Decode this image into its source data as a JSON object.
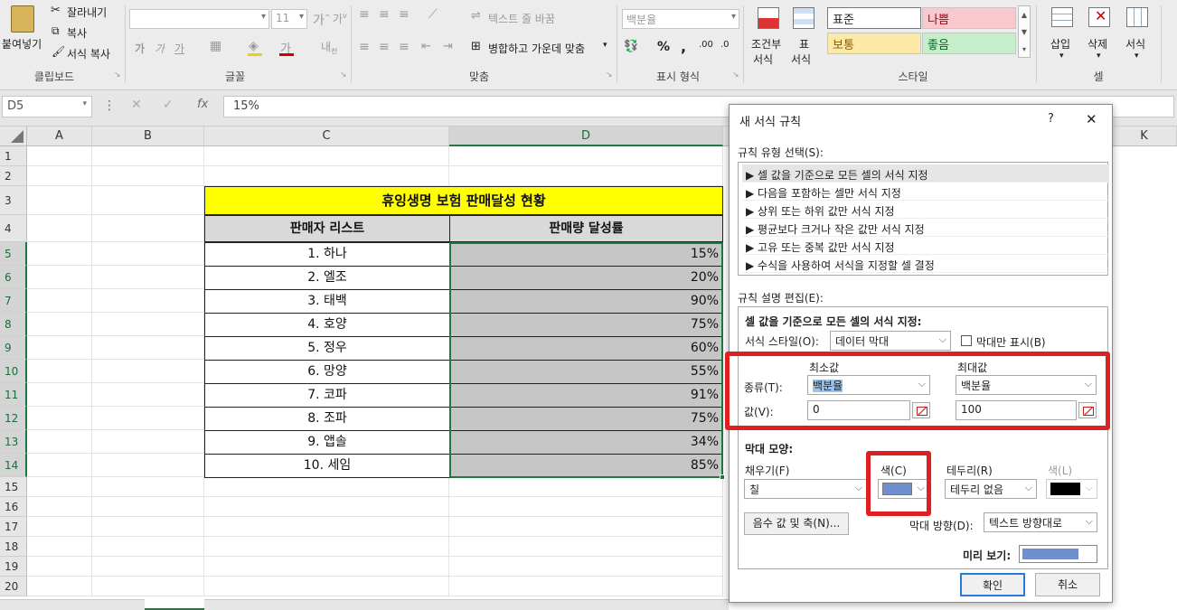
{
  "ribbon": {
    "clipboard": {
      "paste": "붙여넣기",
      "cut": "잘라내기",
      "copy": "복사",
      "format_painter": "서식 복사",
      "group": "클립보드"
    },
    "font": {
      "font_name": "",
      "font_size": "11",
      "bold": "가",
      "italic": "가",
      "underline": "가",
      "group": "글꼴"
    },
    "alignment": {
      "wrap_text": "텍스트 줄 바꿈",
      "merge_center": "병합하고 가운데 맞춤",
      "group": "맞춤"
    },
    "number": {
      "format": "백분율",
      "percent": "%",
      "comma": ",",
      "group": "표시 형식"
    },
    "styles": {
      "cond_format": "조건부",
      "cond_format2": "서식",
      "table_format": "표",
      "table_format2": "서식",
      "normal": "표준",
      "bad": "나쁨",
      "neutral": "보통",
      "good": "좋음",
      "group": "스타일"
    },
    "cells": {
      "insert": "삽입",
      "delete": "삭제",
      "format": "서식",
      "group": "셀"
    }
  },
  "formula_bar": {
    "name_box": "D5",
    "fx": "fx",
    "value": "15%"
  },
  "columns": [
    "A",
    "B",
    "C",
    "D",
    "K"
  ],
  "rows": [
    "1",
    "2",
    "3",
    "4",
    "5",
    "6",
    "7",
    "8",
    "9",
    "10",
    "11",
    "12",
    "13",
    "14",
    "15",
    "16",
    "17",
    "18",
    "19",
    "20"
  ],
  "table": {
    "title": "휴잉생명 보험 판매달성 현황",
    "header_seller": "판매자 리스트",
    "header_rate": "판매량 달성률",
    "sellers": [
      "1. 하나",
      "2. 엘조",
      "3. 태백",
      "4. 호양",
      "5. 정우",
      "6. 망양",
      "7. 코파",
      "8. 조파",
      "9. 앱솔",
      "10. 세임"
    ],
    "rates": [
      "15%",
      "20%",
      "90%",
      "75%",
      "60%",
      "55%",
      "91%",
      "75%",
      "34%",
      "85%"
    ]
  },
  "dialog": {
    "title": "새 서식 규칙",
    "help": "?",
    "close": "✕",
    "rule_type_label": "규칙 유형 선택(S):",
    "rule_types": [
      "▶ 셀 값을 기준으로 모든 셀의 서식 지정",
      "▶ 다음을 포함하는 셀만 서식 지정",
      "▶ 상위 또는 하위 값만 서식 지정",
      "▶ 평균보다 크거나 작은 값만 서식 지정",
      "▶ 고유 또는 중복 값만 서식 지정",
      "▶ 수식을 사용하여 서식을 지정할 셀 결정"
    ],
    "edit_label": "규칙 설명 편집(E):",
    "edit_heading": "셀 값을 기준으로 모든 셀의 서식 지정:",
    "format_style_label": "서식 스타일(O):",
    "format_style_value": "데이터 막대",
    "bar_only_label": "막대만 표시(B)",
    "min_label": "최소값",
    "max_label": "최대값",
    "type_label": "종류(T):",
    "min_type": "백분율",
    "max_type": "백분율",
    "value_label": "값(V):",
    "min_value": "0",
    "max_value": "100",
    "bar_appearance": "막대 모양:",
    "fill_label": "채우기(F)",
    "fill_value": "칠",
    "color_label": "색(C)",
    "border_label": "테두리(R)",
    "border_value": "테두리 없음",
    "border_color_label": "색(L)",
    "negative_button": "음수 값 및 축(N)...",
    "direction_label": "막대 방향(D):",
    "direction_value": "텍스트 방향대로",
    "preview_label": "미리 보기:",
    "ok": "확인",
    "cancel": "취소",
    "bar_color": "#6f8fcf",
    "border_color": "#000000"
  }
}
